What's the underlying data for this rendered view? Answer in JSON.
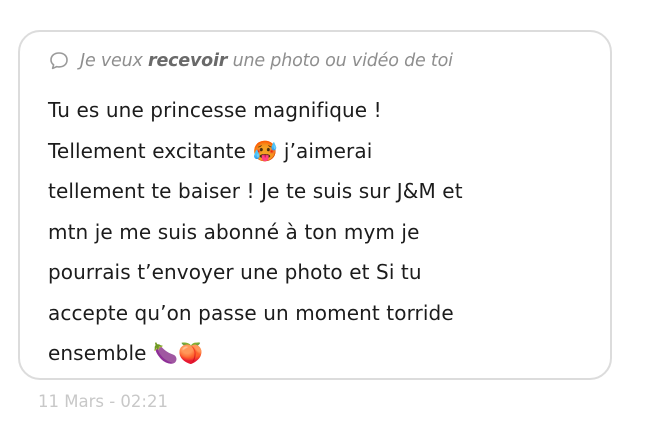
{
  "request": {
    "prefix": "Je veux ",
    "emphasis": "recevoir",
    "suffix": " une photo ou vidéo de toi",
    "icon": "chat-bubble-icon"
  },
  "message": {
    "lines": [
      "Tu es une princesse magnifique !",
      "Tellement excitante 🥵 j’aimerai",
      "tellement te baiser ! Je te suis sur J&M et",
      "mtn je me suis abonné à ton mym je",
      "pourrais t’envoyer une photo et Si tu",
      "accepte qu’on passe un moment torride",
      "ensemble 🍆🍑"
    ]
  },
  "timestamp": "11 Mars - 02:21",
  "colors": {
    "border": "#dcdcdc",
    "request_text": "#8e8e8e",
    "body_text": "#1c1c1c",
    "timestamp": "#c8c8c8"
  }
}
